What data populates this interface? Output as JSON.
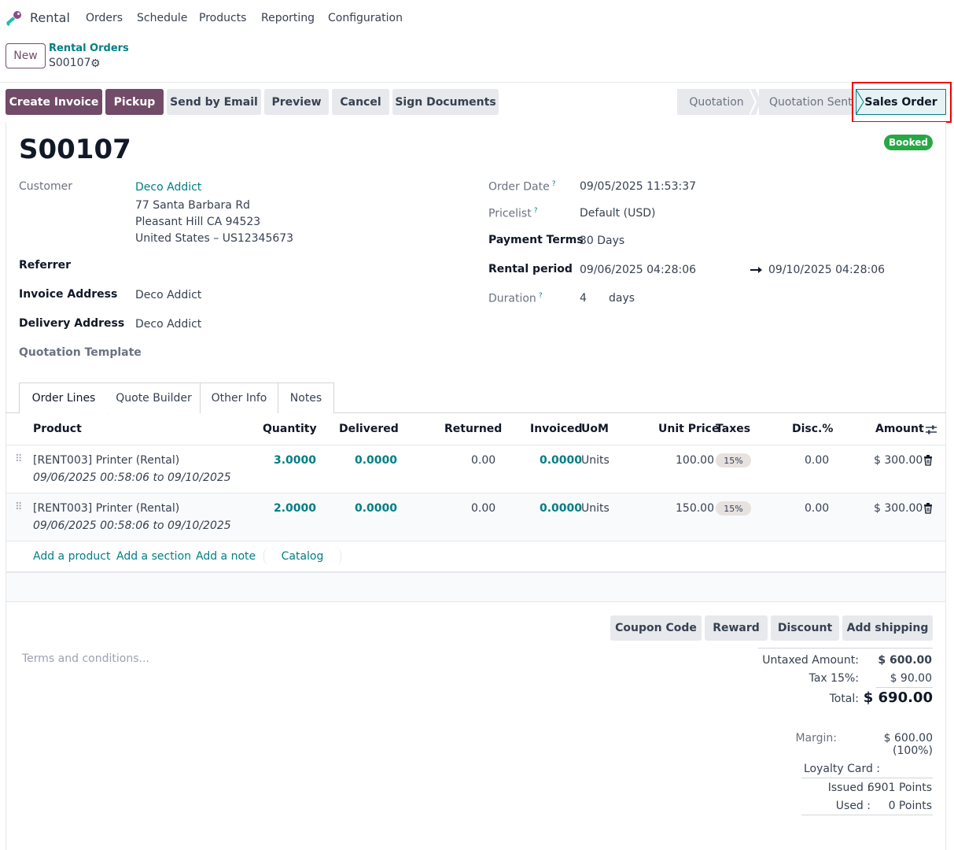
{
  "nav": {
    "app_name": "Rental",
    "items": [
      "Orders",
      "Schedule",
      "Products",
      "Reporting",
      "Configuration"
    ]
  },
  "control_panel": {
    "new_label": "New",
    "breadcrumb_parent": "Rental Orders",
    "breadcrumb_current": "S00107"
  },
  "actions": {
    "create_invoice": "Create Invoice",
    "pickup": "Pickup",
    "send_email": "Send by Email",
    "preview": "Preview",
    "cancel": "Cancel",
    "sign_documents": "Sign Documents"
  },
  "stages": {
    "quotation": "Quotation",
    "quotation_sent": "Quotation Sent",
    "sales_order": "Sales Order"
  },
  "order": {
    "name": "S00107",
    "status_badge": "Booked",
    "customer_label": "Customer",
    "customer_name": "Deco Addict",
    "address_line1": "77 Santa Barbara Rd",
    "address_line2": "Pleasant Hill CA 94523",
    "address_line3": "United States – US12345673",
    "referrer_label": "Referrer",
    "invoice_address_label": "Invoice Address",
    "invoice_address": "Deco Addict",
    "delivery_address_label": "Delivery Address",
    "delivery_address": "Deco Addict",
    "quotation_template_label": "Quotation Template",
    "order_date_label": "Order Date",
    "order_date": "09/05/2025 11:53:37",
    "pricelist_label": "Pricelist",
    "pricelist": "Default (USD)",
    "payment_terms_label": "Payment Terms",
    "payment_terms": "30 Days",
    "rental_period_label": "Rental period",
    "rental_start": "09/06/2025 04:28:06",
    "rental_end": "09/10/2025 04:28:06",
    "duration_label": "Duration",
    "duration_value": "4",
    "duration_unit": "days",
    "help_mark": "?"
  },
  "tabs": [
    "Order Lines",
    "Quote Builder",
    "Other Info",
    "Notes"
  ],
  "table": {
    "headers": {
      "product": "Product",
      "quantity": "Quantity",
      "delivered": "Delivered",
      "returned": "Returned",
      "invoiced": "Invoiced",
      "uom": "UoM",
      "unit_price": "Unit Price",
      "taxes": "Taxes",
      "disc": "Disc.%",
      "amount": "Amount"
    },
    "rows": [
      {
        "product": "[RENT003] Printer (Rental)",
        "period": "09/06/2025 00:58:06 to 09/10/2025",
        "quantity": "3.0000",
        "delivered": "0.0000",
        "returned": "0.00",
        "invoiced": "0.0000",
        "uom": "Units",
        "unit_price": "100.00",
        "tax": "15%",
        "disc": "0.00",
        "amount": "$ 300.00"
      },
      {
        "product": "[RENT003] Printer (Rental)",
        "period": "09/06/2025 00:58:06 to 09/10/2025",
        "quantity": "2.0000",
        "delivered": "0.0000",
        "returned": "0.00",
        "invoiced": "0.0000",
        "uom": "Units",
        "unit_price": "150.00",
        "tax": "15%",
        "disc": "0.00",
        "amount": "$ 300.00"
      }
    ],
    "add_product": "Add a product",
    "add_section": "Add a section",
    "add_note": "Add a note",
    "catalog": "Catalog"
  },
  "footer_buttons": {
    "coupon": "Coupon Code",
    "reward": "Reward",
    "discount": "Discount",
    "shipping": "Add shipping"
  },
  "terms_placeholder": "Terms and conditions...",
  "totals": {
    "untaxed_label": "Untaxed Amount:",
    "untaxed": "$ 600.00",
    "tax_label": "Tax 15%:",
    "tax": "$ 90.00",
    "total_label": "Total:",
    "total": "$ 690.00",
    "margin_label": "Margin:",
    "margin": "$ 600.00 (100%)",
    "loyalty_label": "Loyalty Card :",
    "issued_label": "Issued :",
    "issued": "6901 Points",
    "used_label": "Used :",
    "used": "0 Points"
  },
  "colors": {
    "primary": "#714b67",
    "link": "#017e84",
    "badge_success": "#28a745",
    "highlight": "#ee0000"
  }
}
